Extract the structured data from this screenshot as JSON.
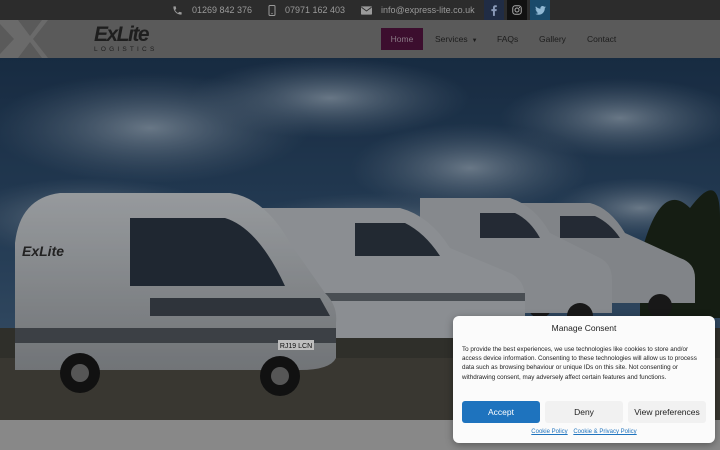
{
  "topbar": {
    "phone": "01269 842 376",
    "mobile": "07971 162 403",
    "email": "info@express-lite.co.uk",
    "icons": [
      "phone-icon",
      "mobile-icon",
      "envelope-icon",
      "facebook-icon",
      "instagram-icon",
      "twitter-icon"
    ]
  },
  "logo": {
    "text": "ExLite",
    "subtext": "LOGISTICS"
  },
  "nav": {
    "items": [
      {
        "label": "Home",
        "active": true
      },
      {
        "label": "Services",
        "dropdown": true
      },
      {
        "label": "FAQs"
      },
      {
        "label": "Gallery"
      },
      {
        "label": "Contact"
      }
    ]
  },
  "hero": {
    "van_logo": "ExLite",
    "plate": "RJ19 LCN"
  },
  "consent": {
    "title": "Manage Consent",
    "body": "To provide the best experiences, we use technologies like cookies to store and/or access device information. Consenting to these technologies will allow us to process data such as browsing behaviour or unique IDs on this site. Not consenting or withdrawing consent, may adversely affect certain features and functions.",
    "accept": "Accept",
    "deny": "Deny",
    "preferences": "View preferences",
    "links": [
      "Cookie Policy",
      "Cookie & Privacy Policy"
    ]
  },
  "colors": {
    "accent": "#1e73be",
    "nav_active_bg": "#3c0e2e",
    "topbar_bg": "#2c2c2c"
  }
}
